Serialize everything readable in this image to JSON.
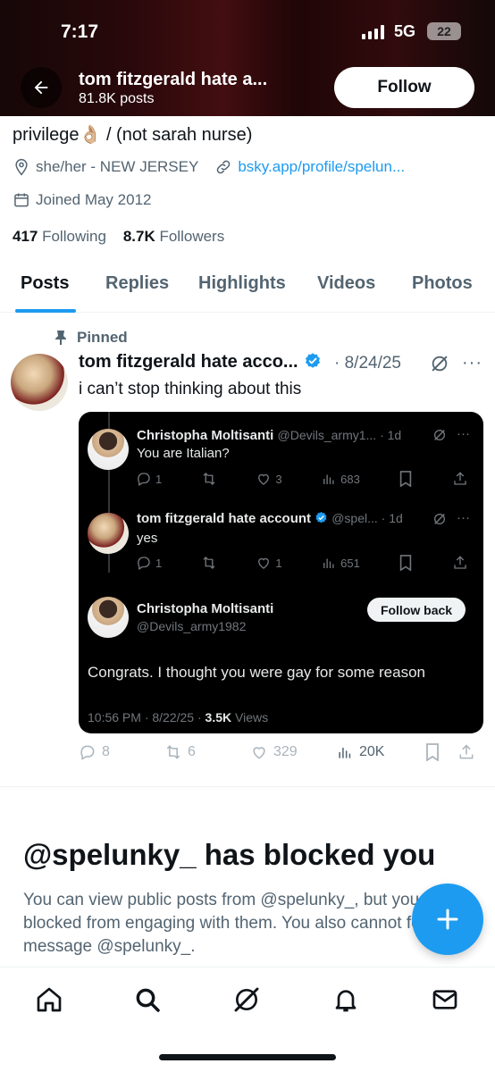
{
  "status_bar": {
    "time": "7:17",
    "network": "5G",
    "battery": "22"
  },
  "header": {
    "title": "tom fitzgerald hate a...",
    "posts_count": "81.8K posts",
    "follow_label": "Follow"
  },
  "profile": {
    "bio_tail": "privilege",
    "bio_emoji": "👌🏼",
    "bio_after": " / (not sarah nurse)",
    "pronouns_location": "she/her - NEW JERSEY",
    "link": "bsky.app/profile/spelun...",
    "joined": "Joined May 2012",
    "following_count": "417",
    "following_label": " Following",
    "followers_count": "8.7K",
    "followers_label": " Followers"
  },
  "tabs": [
    "Posts",
    "Replies",
    "Highlights",
    "Videos",
    "Photos"
  ],
  "post": {
    "pinned_label": "Pinned",
    "author": "tom fitzgerald hate acco...",
    "date": "· 8/24/25",
    "text": "i can’t stop thinking about this",
    "more": "···",
    "actions": {
      "replies": "8",
      "reposts": "6",
      "likes": "329",
      "views": "20K"
    }
  },
  "embed": {
    "tweets": [
      {
        "name": "Christopha Moltisanti",
        "handle": "@Devils_army1... · 1d",
        "text": "You are Italian?",
        "replies": "1",
        "likes": "3",
        "views": "683"
      },
      {
        "name": "tom fitzgerald hate account",
        "handle": "@spel... · 1d",
        "text": "yes",
        "replies": "1",
        "likes": "1",
        "views": "651"
      }
    ],
    "main": {
      "name": "Christopha Moltisanti",
      "handle": "@Devils_army1982",
      "follow_back": "Follow back",
      "text": "Congrats. I thought you were gay for some reason",
      "timestamp": "10:56 PM · 8/22/25 · ",
      "views_count": "3.5K",
      "views_label": " Views"
    }
  },
  "blocked": {
    "title": "@spelunky_ has blocked you",
    "body": "You can view public posts from @spelunky_, but you are blocked from engaging with them. You also cannot follow or message @spelunky_."
  },
  "nav_icons": [
    "home-icon",
    "search-icon",
    "grok-icon",
    "notifications-icon",
    "messages-icon"
  ],
  "colors": {
    "accent": "#1d9bf0",
    "text": "#0f1419",
    "muted": "#536471"
  }
}
